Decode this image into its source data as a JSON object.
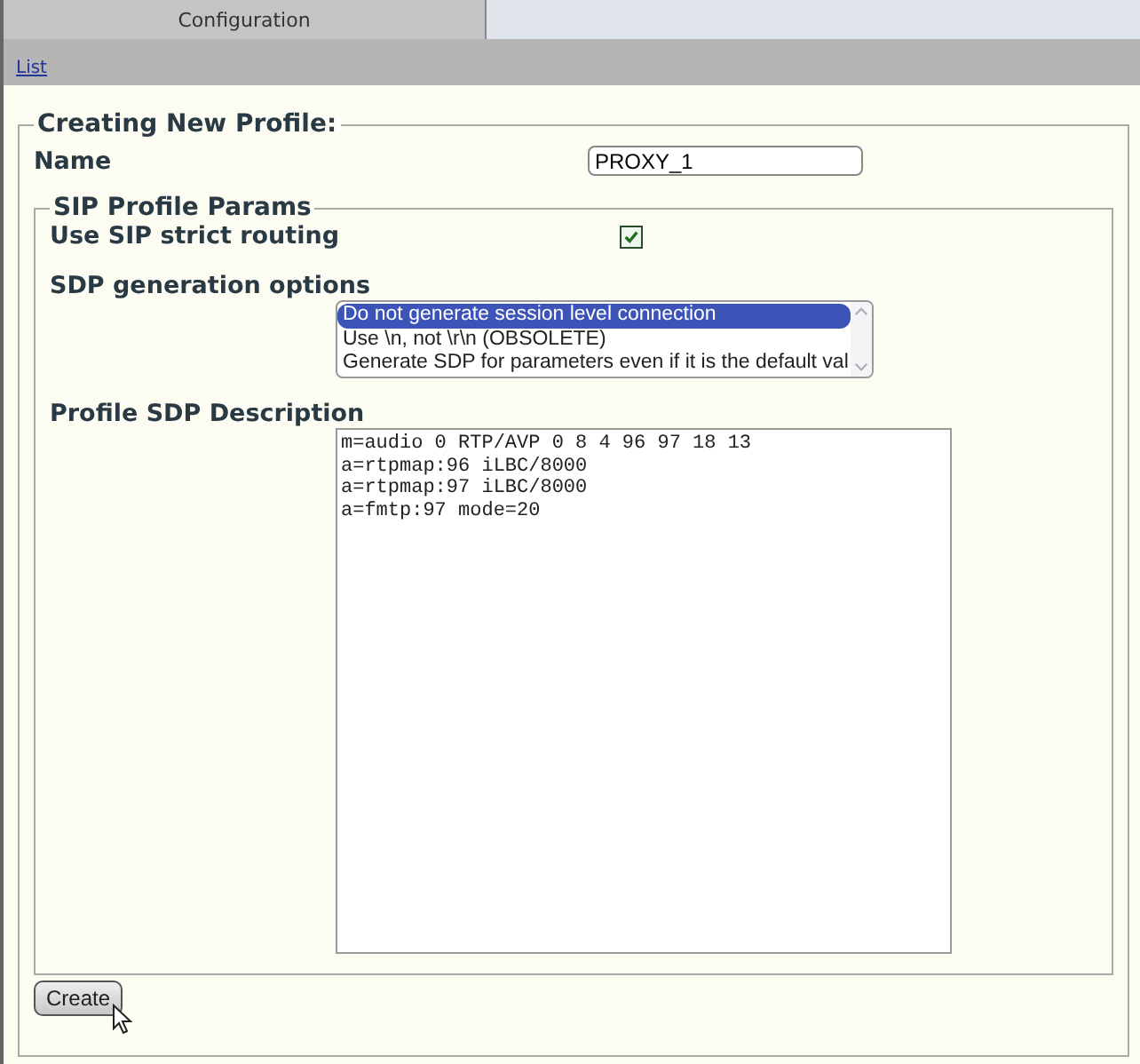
{
  "tabs": [
    {
      "label": "Configuration",
      "selected": true
    }
  ],
  "breadcrumb": {
    "link": "List"
  },
  "form": {
    "legend": "Creating New Profile:",
    "name_label": "Name",
    "name_value": "PROXY_1",
    "section": {
      "legend": "SIP Profile Params",
      "strict_routing": {
        "label": "Use SIP strict routing",
        "checked": true
      },
      "sdp_options": {
        "label": "SDP generation options",
        "options": [
          {
            "label": "Do not generate session level connection",
            "selected": true
          },
          {
            "label": "Use \\n, not \\r\\n (OBSOLETE)",
            "selected": false
          },
          {
            "label": "Generate SDP for parameters even if it is the default val",
            "selected": false
          }
        ]
      },
      "sdp_description": {
        "label": "Profile SDP Description",
        "lines": [
          "m=audio 0 RTP/AVP 0 8 4 96 97 18 13",
          "a=rtpmap:96 iLBC/8000",
          "a=rtpmap:97 iLBC/8000",
          "a=fmtp:97 mode=20"
        ]
      }
    },
    "submit": "Create"
  }
}
